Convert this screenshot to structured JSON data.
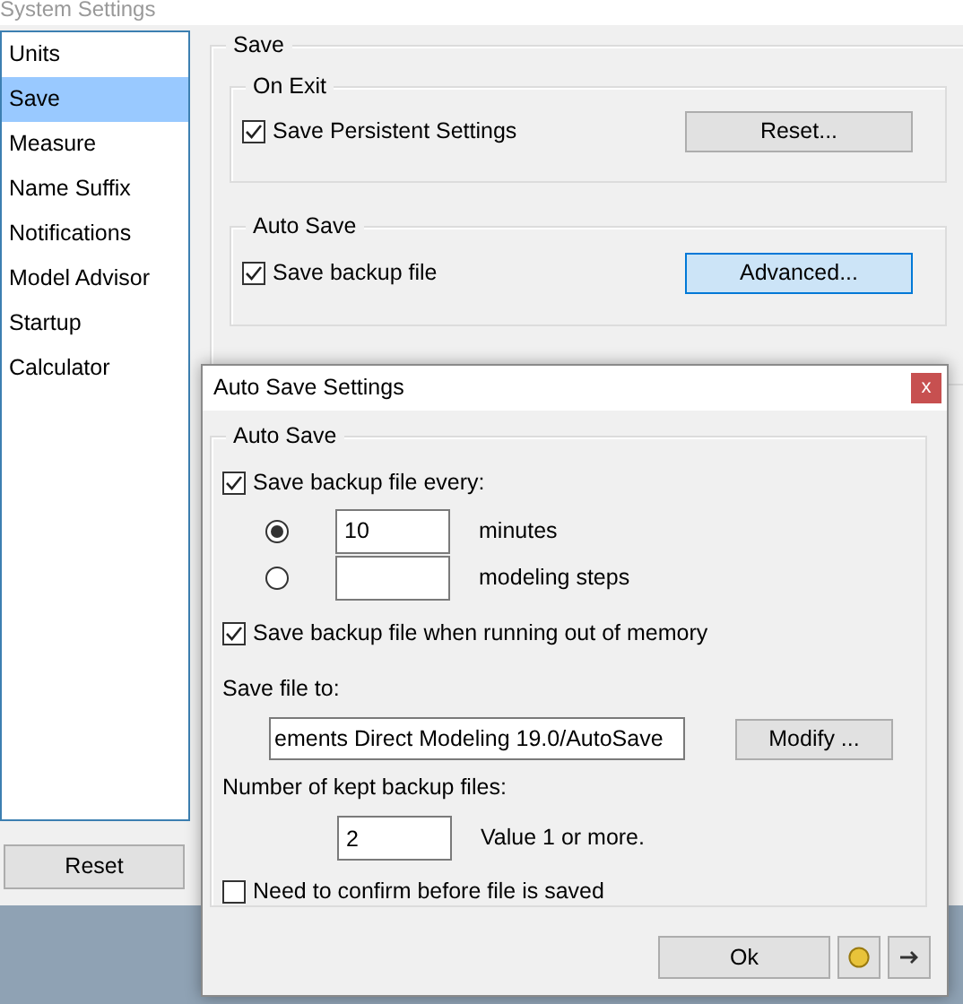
{
  "window": {
    "title": "System Settings"
  },
  "sidebar": {
    "items": [
      {
        "label": "Units",
        "selected": false
      },
      {
        "label": "Save",
        "selected": true
      },
      {
        "label": "Measure",
        "selected": false
      },
      {
        "label": "Name Suffix",
        "selected": false
      },
      {
        "label": "Notifications",
        "selected": false
      },
      {
        "label": "Model Advisor",
        "selected": false
      },
      {
        "label": "Startup",
        "selected": false
      },
      {
        "label": "Calculator",
        "selected": false
      }
    ]
  },
  "reset_button": "Reset",
  "save_group": {
    "title": "Save",
    "on_exit": {
      "title": "On Exit",
      "checkbox": {
        "label": "Save Persistent Settings",
        "checked": true
      },
      "button": {
        "label": "Reset...",
        "focused": false
      }
    },
    "auto_save": {
      "title": "Auto Save",
      "checkbox": {
        "label": "Save backup file",
        "checked": true
      },
      "button": {
        "label": "Advanced...",
        "focused": true
      }
    }
  },
  "dialog": {
    "title": "Auto Save Settings",
    "close": "x",
    "group_title": "Auto Save",
    "save_every": {
      "label": "Save backup file every:",
      "checked": true
    },
    "intervals": [
      {
        "value": "10",
        "unit": "minutes",
        "selected": true
      },
      {
        "unit": "modeling steps",
        "selected": false
      }
    ],
    "out_of_memory": {
      "label": "Save backup file when running out of memory",
      "checked": true
    },
    "save_file_label": "Save file to:",
    "path": "ements Direct Modeling 19.0/AutoSave",
    "modify": "Modify ...",
    "kept_label": "Number of kept backup files:",
    "kept_value": "2",
    "kept_hint": "Value 1 or more.",
    "confirm": {
      "label": "Need to confirm before file is saved",
      "checked": false
    },
    "ok": "Ok"
  }
}
